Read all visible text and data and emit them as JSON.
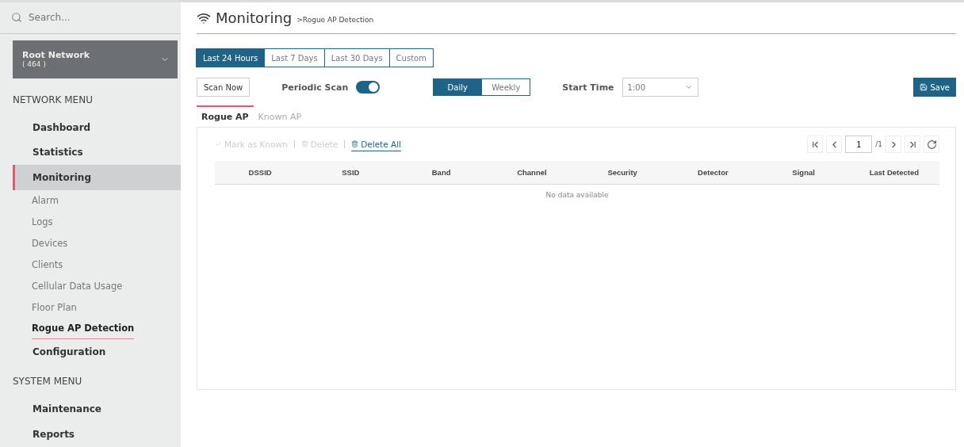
{
  "sidebar": {
    "search": {
      "placeholder": "Search..."
    },
    "network": {
      "name": "Root Network",
      "count": "( 464 )"
    },
    "sections": [
      {
        "title": "NETWORK MENU",
        "items": [
          {
            "label": "Dashboard",
            "selected": false
          },
          {
            "label": "Statistics",
            "selected": false
          },
          {
            "label": "Monitoring",
            "selected": true,
            "children": [
              {
                "label": "Alarm",
                "selected": false
              },
              {
                "label": "Logs",
                "selected": false
              },
              {
                "label": "Devices",
                "selected": false
              },
              {
                "label": "Clients",
                "selected": false
              },
              {
                "label": "Cellular Data Usage",
                "selected": false
              },
              {
                "label": "Floor Plan",
                "selected": false
              },
              {
                "label": "Rogue AP Detection",
                "selected": true
              }
            ]
          },
          {
            "label": "Configuration",
            "selected": false
          }
        ]
      },
      {
        "title": "SYSTEM MENU",
        "items": [
          {
            "label": "Maintenance",
            "selected": false
          },
          {
            "label": "Reports",
            "selected": false
          }
        ]
      }
    ]
  },
  "header": {
    "title": "Monitoring",
    "breadcrumb": ">Rogue AP Detection"
  },
  "ranges": [
    {
      "label": "Last 24 Hours",
      "selected": true
    },
    {
      "label": "Last 7 Days",
      "selected": false
    },
    {
      "label": "Last 30 Days",
      "selected": false
    },
    {
      "label": "Custom",
      "selected": false
    }
  ],
  "scan": {
    "button": "Scan Now",
    "periodic_label": "Periodic Scan",
    "periodic_on": true,
    "frequency": [
      {
        "label": "Daily",
        "selected": true
      },
      {
        "label": "Weekly",
        "selected": false
      }
    ],
    "start_label": "Start Time",
    "start_value": "1:00",
    "save": "Save"
  },
  "tabs": [
    {
      "label": "Rogue AP",
      "selected": true
    },
    {
      "label": "Known AP",
      "selected": false
    }
  ],
  "actions": [
    {
      "label": "Mark as Known",
      "disabled": true
    },
    {
      "label": "Delete",
      "disabled": true
    },
    {
      "label": "Delete All",
      "disabled": false
    }
  ],
  "pager": {
    "page": "1",
    "total": "/1"
  },
  "table": {
    "columns": [
      "DSSID",
      "SSID",
      "Band",
      "Channel",
      "Security",
      "Detector",
      "Signal",
      "Last Detected"
    ],
    "empty": "No data available"
  }
}
